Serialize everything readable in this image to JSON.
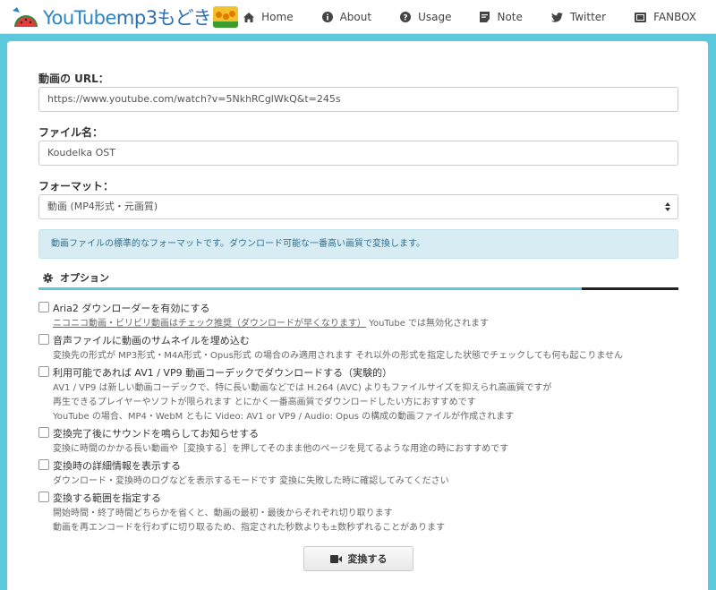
{
  "brand": {
    "name_part1": "YouTube",
    "name_part2": "mp3もどき"
  },
  "nav": [
    {
      "label": "Home",
      "icon": "home-icon"
    },
    {
      "label": "About",
      "icon": "info-icon"
    },
    {
      "label": "Usage",
      "icon": "question-icon"
    },
    {
      "label": "Note",
      "icon": "note-icon"
    },
    {
      "label": "Twitter",
      "icon": "twitter-icon"
    },
    {
      "label": "FANBOX",
      "icon": "video-icon"
    }
  ],
  "form": {
    "url_label": "動画の URL：",
    "url_value": "https://www.youtube.com/watch?v=5NkhRCglWkQ&t=245s",
    "filename_label": "ファイル名：",
    "filename_value": "Koudelka OST",
    "format_label": "フォーマット：",
    "format_value": "動画 (MP4形式・元画質)",
    "info_text": "動画ファイルの標準的なフォーマットです。ダウンロード可能な一番高い画質で変換します。"
  },
  "options": {
    "heading": "オプション",
    "items": [
      {
        "title": "Aria2 ダウンローダーを有効にする",
        "desc_underlined": "ニコニコ動画・ビリビリ動画はチェック推奨（ダウンロードが早くなります）",
        "desc_rest": " YouTube では無効化されます"
      },
      {
        "title": "音声ファイルに動画のサムネイルを埋め込む",
        "desc": "変換先の形式が MP3形式・M4A形式・Opus形式 の場合のみ適用されます それ以外の形式を指定した状態でチェックしても何も起こりません"
      },
      {
        "title": "利用可能であれば AV1 / VP9 動画コーデックでダウンロードする（実験的）",
        "desc1": "AV1 / VP9 は新しい動画コーデックで、特に長い動画などでは H.264 (AVC) よりもファイルサイズを抑えられ高画質ですが",
        "desc2": "再生できるプレイヤーやソフトが限られます とにかく一番高画質でダウンロードしたい方におすすめです",
        "desc3": "YouTube の場合、MP4・WebM ともに Video: AV1 or VP9 / Audio: Opus の構成の動画ファイルが作成されます"
      },
      {
        "title": "変換完了後にサウンドを鳴らしてお知らせする",
        "desc": "変換に時間のかかる長い動画や［変換する］を押してそのまま他のページを見てるような用途の時におすすめです"
      },
      {
        "title": "変換時の詳細情報を表示する",
        "desc": "ダウンロード・変換時のログなどを表示するモードです 変換に失敗した時に確認してみてください"
      },
      {
        "title": "変換する範囲を指定する",
        "desc1": "開始時間・終了時間どちらかを省くと、動画の最初・最後からそれぞれ切り取ります",
        "desc2": "動画を再エンコードを行わずに切り取るため、指定された秒数よりも±数秒ずれることがあります"
      }
    ]
  },
  "convert_label": "変換する",
  "colors": {
    "accent": "#5bc8dc",
    "brand": "#2d86c4",
    "info_bg": "#d7edf3"
  }
}
